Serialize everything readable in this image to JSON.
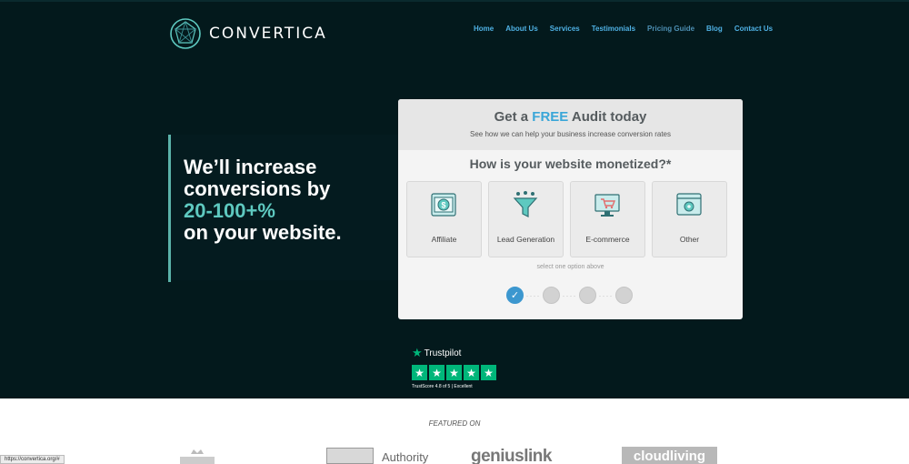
{
  "brand": {
    "name": "CONVERTICA"
  },
  "nav": [
    "Home",
    "About Us",
    "Services",
    "Testimonials",
    "Pricing Guide",
    "Blog",
    "Contact Us"
  ],
  "hero": {
    "line1": "We’ll increase",
    "line2": "conversions by",
    "accent": "20-100+%",
    "line4": "on your website."
  },
  "card": {
    "title_pre": "Get a ",
    "title_free": "FREE",
    "title_post": " Audit today",
    "subtitle": "See how we can help your business increase conversion rates",
    "question": "How is your website monetized?*",
    "options": [
      "Affiliate",
      "Lead Generation",
      "E-commerce",
      "Other"
    ],
    "hint": "select one option above",
    "step_check": "✓"
  },
  "trustpilot": {
    "name": "Trustpilot",
    "star": "★",
    "score_text": "TrustScore 4.8 of 5 | Excellent"
  },
  "featured": {
    "heading": "FEATURED ON",
    "logos": [
      "Authority",
      "geniuslink",
      "cloudliving"
    ]
  },
  "status_url": "https://convertica.org/#",
  "colors": {
    "hero_bg": "#03191c",
    "accent": "#5ec9c0",
    "nav_link": "#4fb1e4",
    "free": "#3aa6d8",
    "trustpilot_green": "#00b67a"
  },
  "icons": [
    "convertica-logo-icon",
    "affiliate-money-icon",
    "lead-funnel-icon",
    "ecommerce-cart-icon",
    "other-browser-icon",
    "trustpilot-star-icon",
    "check-icon",
    "crown-logo-icon"
  ]
}
